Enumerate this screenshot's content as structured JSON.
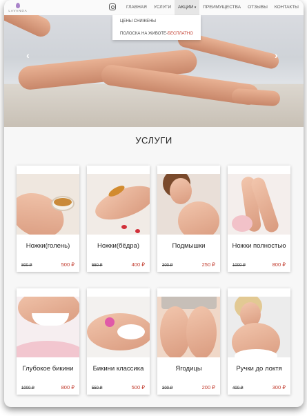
{
  "logo": {
    "text": "LAVANDA"
  },
  "nav": {
    "items": [
      "ГЛАВНАЯ",
      "УСЛУГИ",
      "АКЦИИ",
      "ПРЕИМУЩЕСТВА",
      "ОТЗЫВЫ",
      "КОНТАКТЫ"
    ],
    "active_index": 2
  },
  "dropdown": {
    "item1": "ЦЕНЫ СНИЖЕНЫ",
    "item2_prefix": "ПОЛОСКА НА ЖИВОТЕ-",
    "item2_free": "БЕСПЛАТНО"
  },
  "colors": {
    "accent": "#c0392b",
    "logo": "#a983c9"
  },
  "icons": {
    "instagram": "instagram-icon",
    "slider_prev": "chevron-left-icon",
    "slider_next": "chevron-right-icon"
  },
  "hero": {
    "prev": "‹",
    "next": "›"
  },
  "services": {
    "title": "УСЛУГИ",
    "cards": [
      {
        "title": "Ножки(голень)",
        "old_price": "800 ₽",
        "new_price": "500 ₽"
      },
      {
        "title": "Ножки(бёдра)",
        "old_price": "550 ₽",
        "new_price": "400 ₽"
      },
      {
        "title": "Подмышки",
        "old_price": "300 ₽",
        "new_price": "250 ₽"
      },
      {
        "title": "Ножки полностью",
        "old_price": "1000 ₽",
        "new_price": "800 ₽"
      },
      {
        "title": "Глубокое бикини",
        "old_price": "1000 ₽",
        "new_price": "800 ₽"
      },
      {
        "title": "Бикини классика",
        "old_price": "550 ₽",
        "new_price": "500 ₽"
      },
      {
        "title": "Ягодицы",
        "old_price": "300 ₽",
        "new_price": "200 ₽"
      },
      {
        "title": "Ручки до локтя",
        "old_price": "400 ₽",
        "new_price": "300 ₽"
      }
    ]
  }
}
